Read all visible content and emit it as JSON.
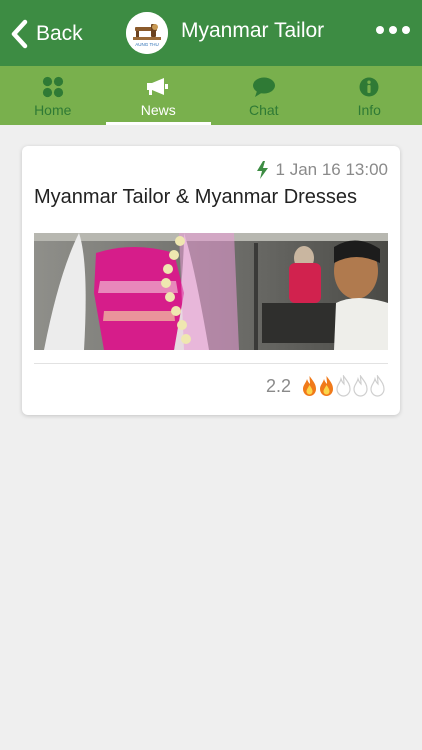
{
  "header": {
    "back_label": "Back",
    "title": "Myanmar Tailor",
    "logo_text": "AUNG THU"
  },
  "tabs": [
    {
      "label": "Home",
      "icon": "grid-icon",
      "active": false
    },
    {
      "label": "News",
      "icon": "megaphone-icon",
      "active": true
    },
    {
      "label": "Chat",
      "icon": "chat-bubble-icon",
      "active": false
    },
    {
      "label": "Info",
      "icon": "info-icon",
      "active": false
    }
  ],
  "post": {
    "timestamp": "1 Jan 16 13:00",
    "title": "Myanmar Tailor & Myanmar Dresses",
    "rating": "2.2",
    "rating_level": 2,
    "rating_max": 5
  },
  "colors": {
    "header_bg": "#3d8c43",
    "tabbar_bg": "#79b04d",
    "tab_inactive": "#2f7a35",
    "flame_active": "#f07a1a",
    "flame_inactive": "#cfcfcf"
  }
}
